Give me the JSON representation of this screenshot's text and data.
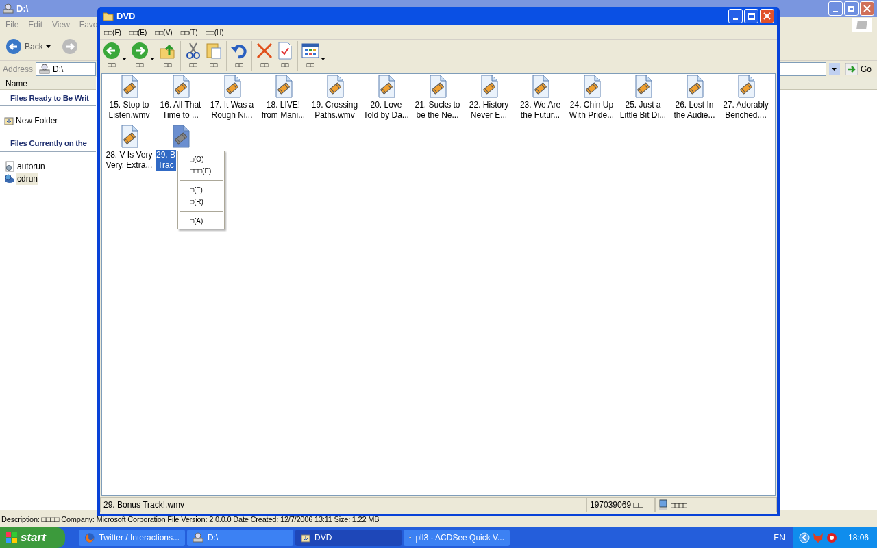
{
  "back_window": {
    "title": "D:\\",
    "menu": [
      "File",
      "Edit",
      "View",
      "Favo"
    ],
    "back_label": "Back",
    "address_label": "Address",
    "address": "D:\\",
    "go_label": "Go",
    "column": "Name",
    "sections": [
      {
        "title": "Files Ready to Be Writ",
        "items": [
          {
            "kind": "folder",
            "label": "New Folder",
            "selected": false
          }
        ]
      },
      {
        "title": "Files Currently on the",
        "items": [
          {
            "kind": "settings",
            "label": "autorun",
            "selected": false
          },
          {
            "kind": "setup",
            "label": "cdrun",
            "selected": true
          }
        ]
      }
    ],
    "description": "Description: □□□□ Company: Microsoft Corporation File Version: 2.0.0.0 Date Created: 12/7/2006 13:11 Size: 1.22 MB"
  },
  "window": {
    "title": "DVD",
    "menu": [
      "□□(F)",
      "□□(E)",
      "□□(V)",
      "□□(T)",
      "□□(H)"
    ],
    "toolbar": [
      {
        "kind": "back",
        "label": "□□",
        "dropdown": true
      },
      {
        "kind": "forward",
        "label": "□□",
        "dropdown": true
      },
      {
        "kind": "up",
        "label": "□□",
        "dropdown": false
      },
      {
        "kind": "sep"
      },
      {
        "kind": "cut",
        "label": "□□",
        "dropdown": false
      },
      {
        "kind": "paste",
        "label": "□□",
        "dropdown": false
      },
      {
        "kind": "sep"
      },
      {
        "kind": "undo",
        "label": "□□",
        "dropdown": false
      },
      {
        "kind": "sep"
      },
      {
        "kind": "delete",
        "label": "□□",
        "dropdown": false
      },
      {
        "kind": "properties",
        "label": "□□",
        "dropdown": false
      },
      {
        "kind": "sep"
      },
      {
        "kind": "views",
        "label": "□□",
        "dropdown": true
      }
    ],
    "files": [
      {
        "lines": [
          "15. Stop to",
          "Listen.wmv"
        ],
        "selected": false
      },
      {
        "lines": [
          "16. All That",
          "Time to ..."
        ],
        "selected": false
      },
      {
        "lines": [
          "17. It Was a",
          "Rough Ni..."
        ],
        "selected": false
      },
      {
        "lines": [
          "18. LIVE!",
          "from Mani..."
        ],
        "selected": false
      },
      {
        "lines": [
          "19. Crossing",
          "Paths.wmv"
        ],
        "selected": false
      },
      {
        "lines": [
          "20. Love",
          "Told by Da..."
        ],
        "selected": false
      },
      {
        "lines": [
          "21. Sucks to",
          "be the Ne..."
        ],
        "selected": false
      },
      {
        "lines": [
          "22. History",
          "Never E..."
        ],
        "selected": false
      },
      {
        "lines": [
          "23. We Are",
          "the Futur..."
        ],
        "selected": false
      },
      {
        "lines": [
          "24. Chin Up",
          "With Pride..."
        ],
        "selected": false
      },
      {
        "lines": [
          "25. Just a",
          "Little Bit Di..."
        ],
        "selected": false
      },
      {
        "lines": [
          "26. Lost In",
          "the Audie..."
        ],
        "selected": false
      },
      {
        "lines": [
          "27. Adorably",
          "Benched...."
        ],
        "selected": false
      },
      {
        "lines": [
          "28. V Is Very",
          "Very, Extra..."
        ],
        "selected": false
      },
      {
        "lines": [
          "29. B",
          "Trac"
        ],
        "selected": true
      }
    ],
    "context_menu": [
      {
        "kind": "item",
        "label": "□(O)"
      },
      {
        "kind": "item",
        "label": "□□□(E)"
      },
      {
        "kind": "sep"
      },
      {
        "kind": "item",
        "label": "□(F)"
      },
      {
        "kind": "item",
        "label": "□(R)"
      },
      {
        "kind": "sep"
      },
      {
        "kind": "item",
        "label": "□(A)"
      }
    ],
    "status": {
      "name": "29. Bonus Track!.wmv",
      "size": "197039069 □□",
      "zone": "□□□□"
    }
  },
  "taskbar": {
    "start": "start",
    "tasks": [
      {
        "label": "Twitter / Interactions...",
        "kind": "browser",
        "selected": false
      },
      {
        "label": "D:\\",
        "kind": "drive",
        "selected": false
      },
      {
        "label": "DVD",
        "kind": "folder",
        "selected": true
      },
      {
        "label": "pll3 - ACDSee Quick V...",
        "kind": "viewer",
        "selected": false
      }
    ],
    "lang": "EN",
    "time": "18:06"
  }
}
